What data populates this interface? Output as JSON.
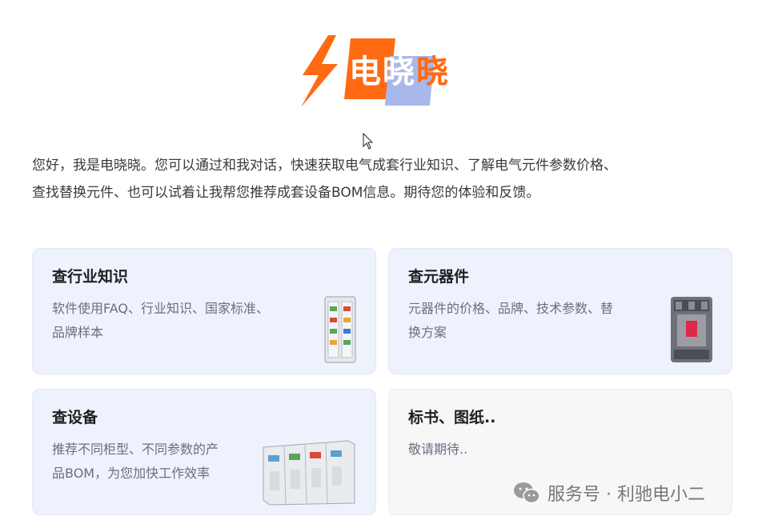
{
  "logo": {
    "brand_chars": [
      "电",
      "晓",
      "晓"
    ],
    "bolt_icon": "lightning-bolt-icon",
    "colors": {
      "orange": "#ff6a12",
      "blue": "#a9b8ea"
    }
  },
  "intro": {
    "line1": "您好，我是电晓晓。您可以通过和我对话，快速获取电气成套行业知识、了解电气元件参数价格、",
    "line2": "查找替换元件、也可以试着让我帮您推荐成套设备BOM信息。期待您的体验和反馈。"
  },
  "cards": [
    {
      "title": "查行业知识",
      "desc_line1": "软件使用FAQ、行业知识、国家标准、",
      "desc_line2": "品牌样本",
      "image": "switchgear-cabinet-icon"
    },
    {
      "title": "查元器件",
      "desc_line1": "元器件的价格、品牌、技术参数、替",
      "desc_line2": "换方案",
      "image": "circuit-breaker-icon"
    },
    {
      "title": "查设备",
      "desc_line1": "推荐不同柜型、不同参数的产",
      "desc_line2": "品BOM，为您加快工作效率",
      "image": "cabinet-row-icon"
    },
    {
      "title": "标书、图纸..",
      "desc_line1": "敬请期待..",
      "desc_line2": ""
    }
  ],
  "watermark": {
    "text": "服务号 · 利驰电小二",
    "icon": "wechat-icon"
  },
  "colors": {
    "card_bg": "#eef2fd",
    "card_disabled_bg": "#f7f7f8",
    "accent": "#ff6a12"
  }
}
